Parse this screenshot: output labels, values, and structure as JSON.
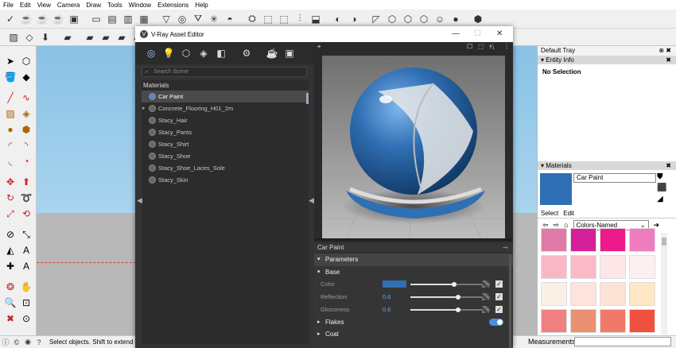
{
  "menu": [
    "File",
    "Edit",
    "View",
    "Camera",
    "Draw",
    "Tools",
    "Window",
    "Extensions",
    "Help"
  ],
  "status": {
    "message": "Select objects. Shift to extend",
    "measurements_label": "Measurements"
  },
  "tray": {
    "title": "Default Tray",
    "pin": "✖",
    "entity_info": {
      "title": "Entity Info",
      "value": "No Selection"
    },
    "materials": {
      "title": "Materials",
      "current": "Car Paint",
      "current_color": "#2f6fb3",
      "tabs": [
        "Select",
        "Edit"
      ],
      "collection": "Colors-Named",
      "swatches": [
        "#e07aa6",
        "#d6209a",
        "#ee1a8c",
        "#f07cc0",
        "#f9b7c6",
        "#fbb9c7",
        "#fde6e6",
        "#fef0f2",
        "#faf0e6",
        "#fce4dc",
        "#fde3d6",
        "#fde7c4",
        "#f08080",
        "#e8906f",
        "#f07a6a",
        "#f05040"
      ]
    }
  },
  "vray": {
    "title": "V-Ray Asset Editor",
    "search_placeholder": "Search Scene",
    "list_header": "Materials",
    "materials": [
      {
        "name": "Car Paint",
        "selected": true,
        "expandable": false
      },
      {
        "name": "Concrete_Flooring_H01_2m",
        "selected": false,
        "expandable": true
      },
      {
        "name": "Stacy_Hair",
        "selected": false,
        "expandable": false
      },
      {
        "name": "Stacy_Pants",
        "selected": false,
        "expandable": false
      },
      {
        "name": "Stacy_Shirt",
        "selected": false,
        "expandable": false
      },
      {
        "name": "Stacy_Shoe",
        "selected": false,
        "expandable": false
      },
      {
        "name": "Stacy_Shoe_Laces_Sole",
        "selected": false,
        "expandable": false
      },
      {
        "name": "Stacy_Skin",
        "selected": false,
        "expandable": false
      }
    ],
    "params": {
      "material_name": "Car Paint",
      "section": "Parameters",
      "subsection": "Base",
      "rows": [
        {
          "label": "Color",
          "value": "",
          "swatch": "#2f6fb3",
          "level": 0.55
        },
        {
          "label": "Reflection",
          "value": "0.6",
          "level": 0.6
        },
        {
          "label": "Glossiness",
          "value": "0.6",
          "level": 0.6
        }
      ],
      "flakes": "Flakes",
      "coat": "Coat"
    }
  }
}
